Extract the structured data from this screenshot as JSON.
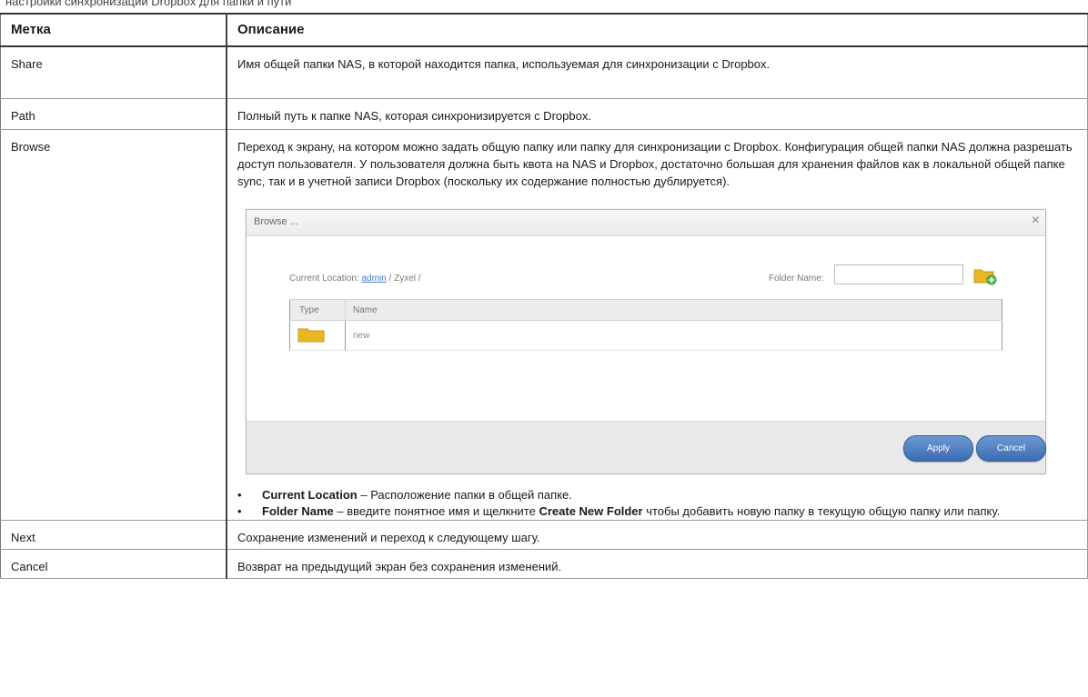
{
  "top_strip": "настройки синхронизации Dropbox для папки и пути",
  "table": {
    "headers": {
      "label": "Метка",
      "description": "Описание"
    },
    "rows": {
      "share": {
        "label": "Share",
        "description": "Имя общей папки NAS, в которой находится папка, используемая для синхронизации с Dropbox."
      },
      "path": {
        "label": "Path",
        "description": "Полный путь к папке NAS, которая синхронизируется с Dropbox."
      },
      "browse": {
        "label": "Browse",
        "description": "Переход к экрану, на котором можно задать общую папку или папку для синхронизации с Dropbox. Конфигурация общей папки NAS должна разрешать доступ пользователя. У пользователя должна быть квота на NAS и Dropbox, достаточно большая для хранения файлов как в локальной общей папке sync, так и в учетной записи Dropbox (поскольку их содержание полностью дублируется).",
        "dialog": {
          "title": "Browse ...",
          "close_glyph": "×",
          "current_location_label": "Current Location:",
          "location_link": "admin",
          "location_rest": " / Zyxel /",
          "folder_name_label": "Folder Name:",
          "folder_name_value": "",
          "grid_headers": {
            "type": "Type",
            "name": "Name"
          },
          "grid_rows": [
            {
              "name": "new"
            }
          ],
          "apply_label": "Apply",
          "cancel_label": "Cancel"
        },
        "bullets": [
          {
            "term": "Current Location",
            "text": " – Расположение папки в общей папке."
          },
          {
            "term": "Folder Name",
            "text": " – введите понятное имя и щелкните ",
            "term2": "Create New Folder",
            "text2": " чтобы добавить новую папку в текущую общую папку или папку."
          }
        ],
        "bullet_glyph": "•"
      },
      "next": {
        "label": "Next",
        "description": "Сохранение изменений и переход к следующему шагу."
      },
      "cancel": {
        "label": "Cancel",
        "description": "Возврат на предыдущий экран без сохранения изменений."
      }
    }
  },
  "colors": {
    "button_blue": "#3c6cb2",
    "folder_yellow": "#e8b722",
    "link_blue": "#4a7fc4"
  },
  "icons": {
    "folder": "folder-icon",
    "new_folder": "new-folder-icon",
    "close": "close-icon"
  }
}
